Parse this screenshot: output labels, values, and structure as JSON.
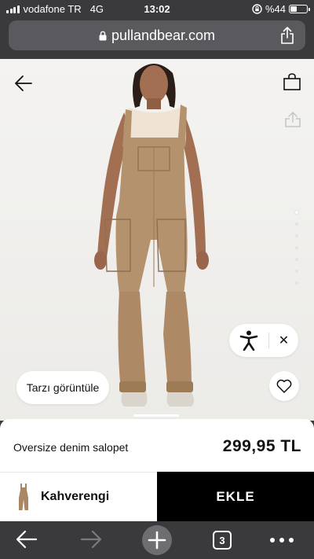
{
  "status": {
    "carrier": "vodafone TR",
    "network": "4G",
    "time": "13:02",
    "battery": "%44",
    "battery_level": 0.44
  },
  "browser": {
    "url": "pullandbear.com",
    "tabs_count": "3"
  },
  "product": {
    "name": "Oversize denim salopet",
    "price": "299,95 TL",
    "color_name": "Kahverengi",
    "add_label": "EKLE",
    "style_button": "Tarzı görüntüle",
    "image_count": 7,
    "active_image": 1,
    "colors": {
      "denim": "#b4926e",
      "denim_dark": "#8e6f50",
      "shirt": "#efe4d4",
      "skin": "#a26f53",
      "background": "#f1f0ee"
    }
  }
}
